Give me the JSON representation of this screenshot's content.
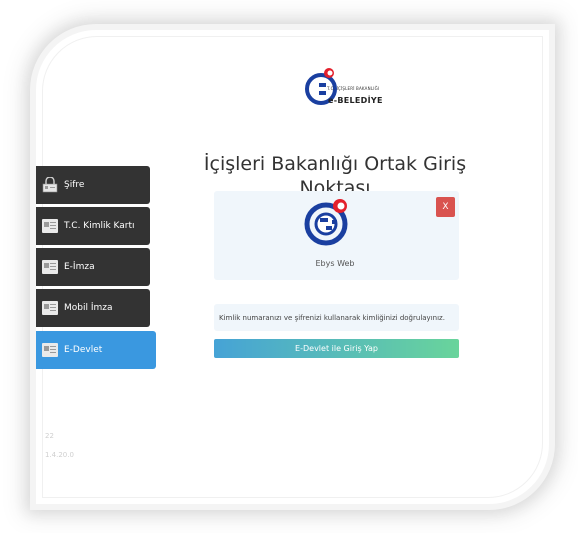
{
  "logo": {
    "sub": "T.C. İÇİŞLERİ BAKANLIĞI",
    "main": "e-BELEDİYE"
  },
  "title": "İçişleri Bakanlığı Ortak Giriş Noktası",
  "menu": [
    {
      "label": "Şifre",
      "icon": "lock-user-icon"
    },
    {
      "label": "T.C. Kimlik Kartı",
      "icon": "id-card-icon"
    },
    {
      "label": "E-İmza",
      "icon": "id-card-icon"
    },
    {
      "label": "Mobil İmza",
      "icon": "id-card-icon"
    },
    {
      "label": "E-Devlet",
      "icon": "id-card-icon",
      "active": true
    }
  ],
  "panel": {
    "close_label": "X",
    "app_name": "Ebys Web"
  },
  "info_text": "Kimlik numaranızı ve şifrenizi kullanarak kimliğinizi doğrulayınız.",
  "edevlet_button": "E-Devlet ile Giriş Yap",
  "version": {
    "line1": "22",
    "line2": "1.4.20.0"
  },
  "colors": {
    "menu_bg": "#333333",
    "menu_active": "#3a98e0",
    "close_btn": "#d9534f",
    "button_gradient_start": "#46a3d6",
    "button_gradient_end": "#69d49b",
    "brand_blue": "#1a3fa0",
    "brand_red": "#e3202c"
  }
}
